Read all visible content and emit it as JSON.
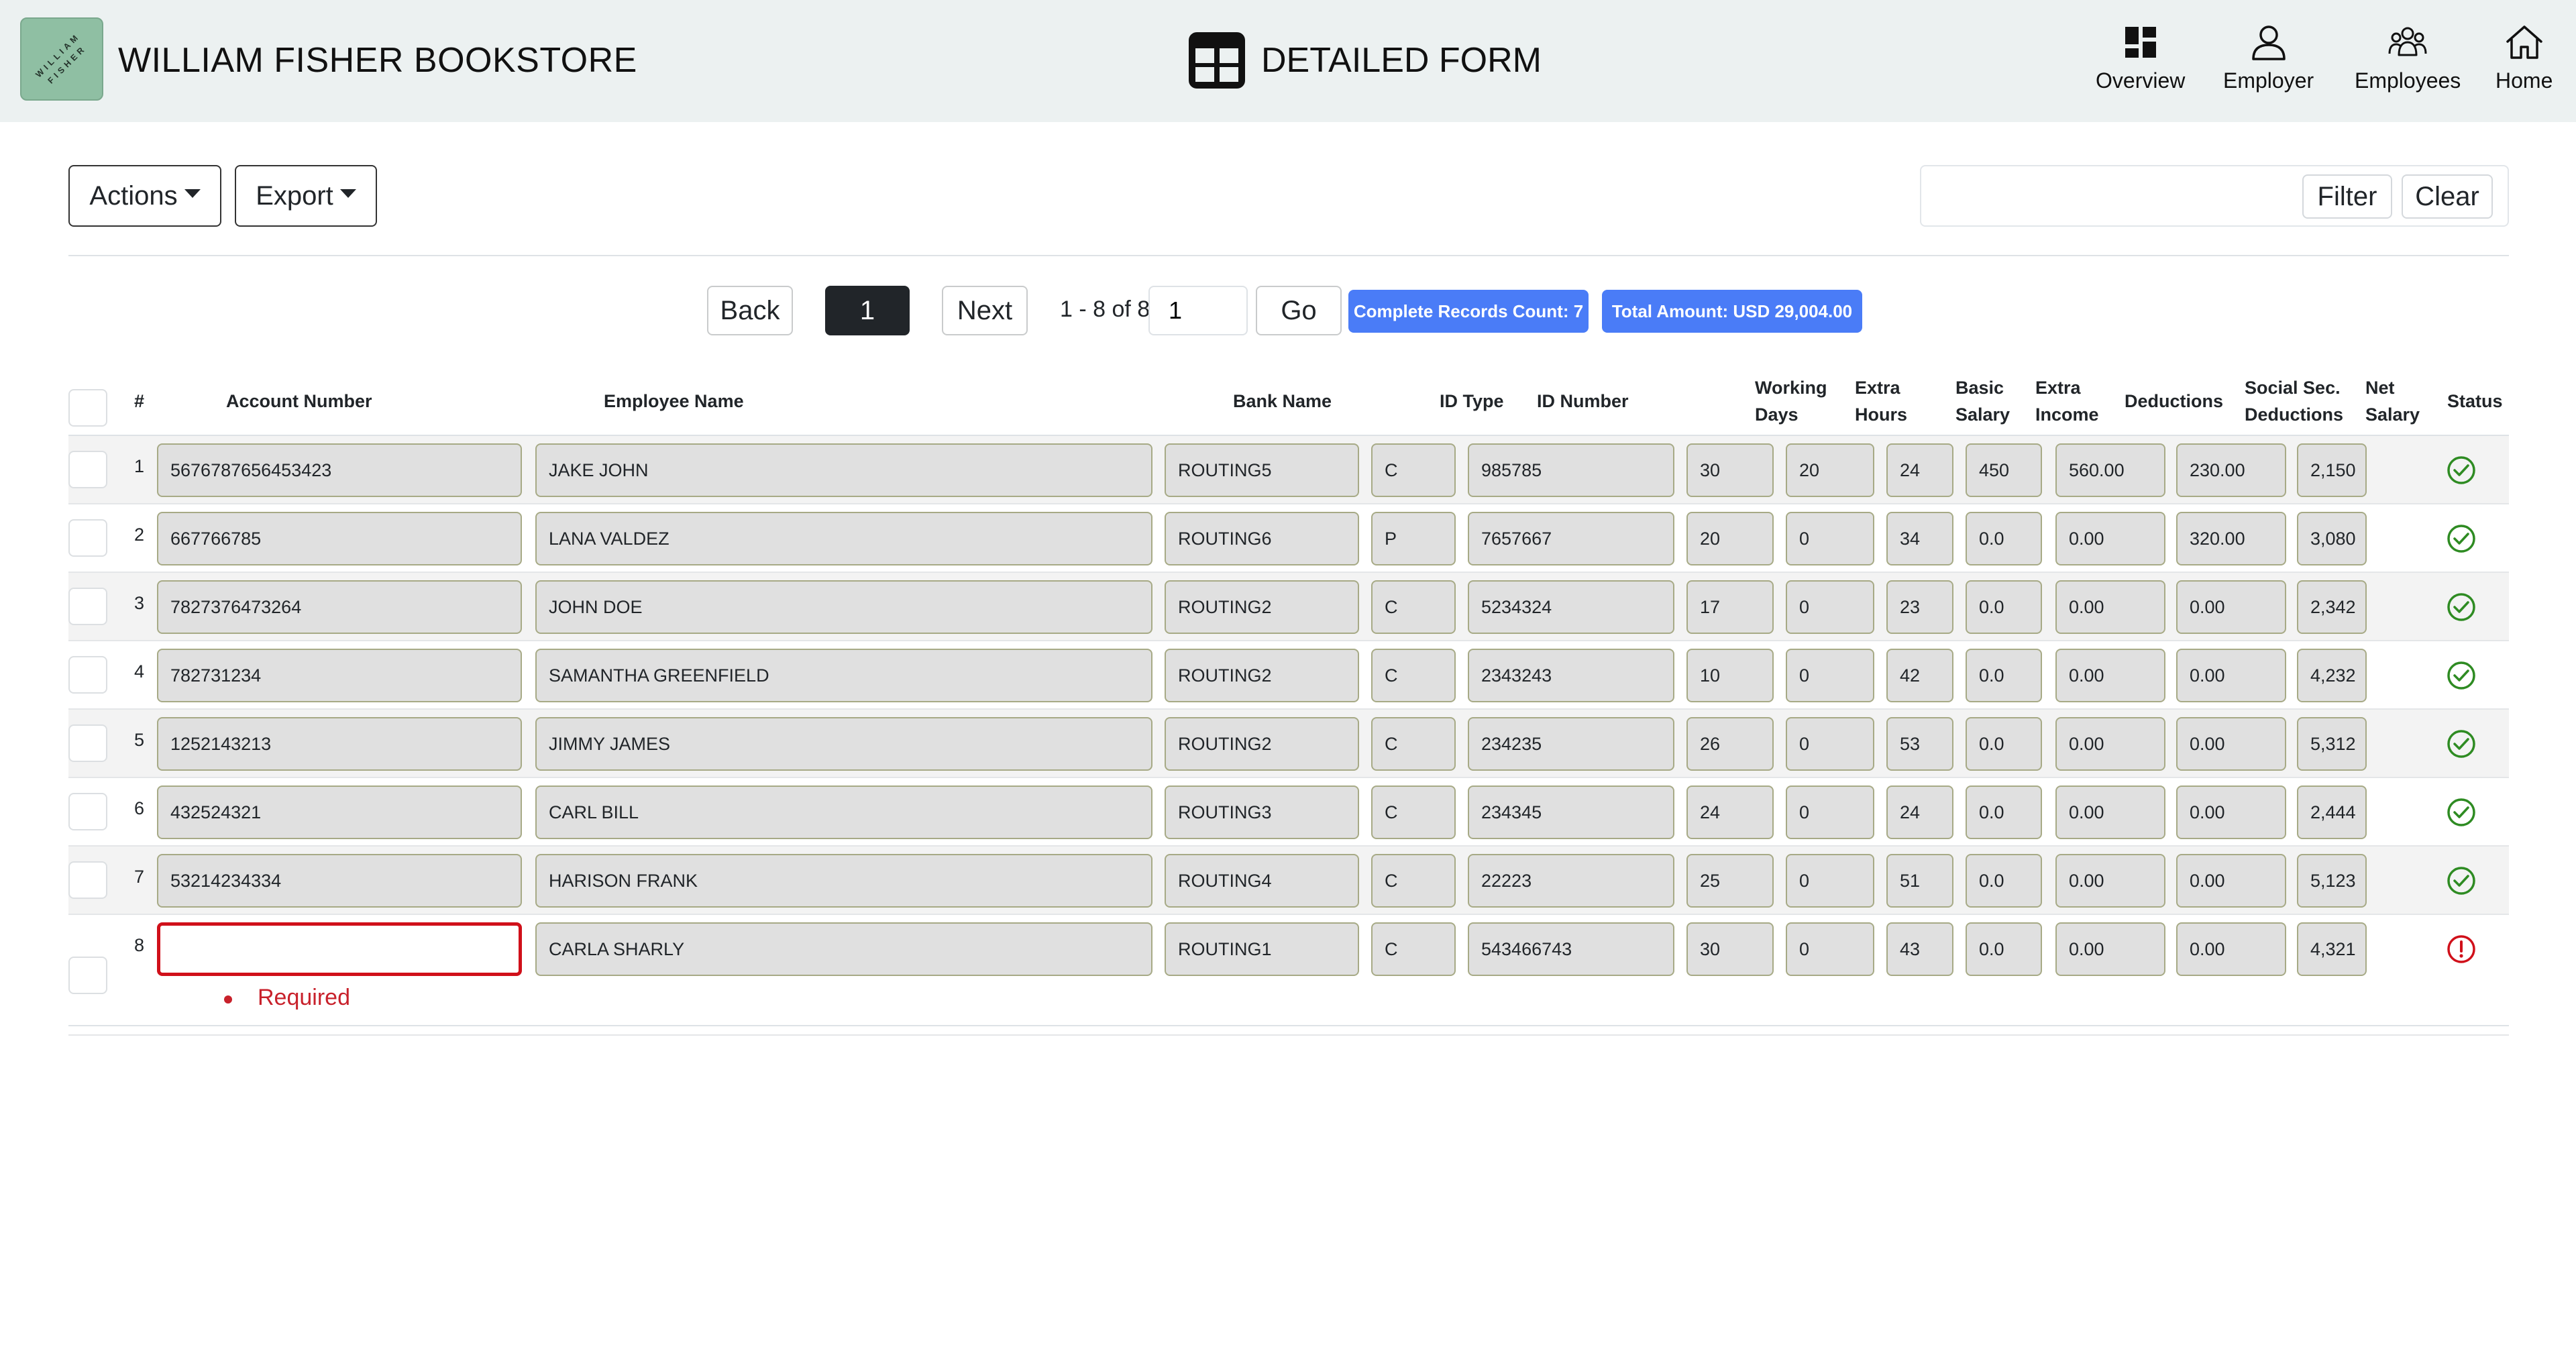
{
  "header": {
    "brand": "WILLIAM FISHER BOOKSTORE",
    "form_title": "DETAILED FORM",
    "nav": [
      {
        "label": "Overview",
        "icon": "dashboard-icon"
      },
      {
        "label": "Employer",
        "icon": "person-icon"
      },
      {
        "label": "Employees",
        "icon": "group-icon"
      },
      {
        "label": "Home",
        "icon": "home-icon"
      }
    ]
  },
  "toolbar": {
    "actions_label": "Actions",
    "export_label": "Export",
    "filter_value": "",
    "filter_label": "Filter",
    "clear_label": "Clear"
  },
  "pagination": {
    "back_label": "Back",
    "current_page": "1",
    "next_label": "Next",
    "range_text": "1 - 8 of 8",
    "page_input_value": "1",
    "go_label": "Go",
    "complete_badge": "Complete Records Count: 7",
    "total_badge": "Total Amount: USD 29,004.00"
  },
  "table": {
    "columns": [
      "#",
      "Account Number",
      "Employee Name",
      "Bank Name",
      "ID Type",
      "ID Number",
      "Working Days",
      "Extra Hours",
      "Basic Salary",
      "Extra Income",
      "Deductions",
      "Social Sec. Deductions",
      "Net Salary",
      "Status"
    ],
    "header_lines": {
      "working_days": [
        "Working",
        "Days"
      ],
      "extra_hours": [
        "Extra",
        "Hours"
      ],
      "basic_salary": [
        "Basic",
        "Salary"
      ],
      "extra_income": [
        "Extra",
        "Income"
      ],
      "social_sec": [
        "Social Sec.",
        "Deductions"
      ],
      "net_salary": [
        "Net",
        "Salary"
      ]
    },
    "rows": [
      {
        "index": "1",
        "account": "5676787656453423",
        "name": "JAKE JOHN",
        "bank": "ROUTING5",
        "id_type": "C",
        "id_number": "985785",
        "working_days": "30",
        "extra_hours": "20",
        "basic_salary": "24",
        "extra_income": "450",
        "deductions": "560.00",
        "social_sec": "230.00",
        "net_salary": "2,150",
        "status": "ok"
      },
      {
        "index": "2",
        "account": "667766785",
        "name": "LANA VALDEZ",
        "bank": "ROUTING6",
        "id_type": "P",
        "id_number": "7657667",
        "working_days": "20",
        "extra_hours": "0",
        "basic_salary": "34",
        "extra_income": "0.0",
        "deductions": "0.00",
        "social_sec": "320.00",
        "net_salary": "3,080",
        "status": "ok"
      },
      {
        "index": "3",
        "account": "7827376473264",
        "name": "JOHN DOE",
        "bank": "ROUTING2",
        "id_type": "C",
        "id_number": "5234324",
        "working_days": "17",
        "extra_hours": "0",
        "basic_salary": "23",
        "extra_income": "0.0",
        "deductions": "0.00",
        "social_sec": "0.00",
        "net_salary": "2,342",
        "status": "ok"
      },
      {
        "index": "4",
        "account": "782731234",
        "name": "SAMANTHA GREENFIELD",
        "bank": "ROUTING2",
        "id_type": "C",
        "id_number": "2343243",
        "working_days": "10",
        "extra_hours": "0",
        "basic_salary": "42",
        "extra_income": "0.0",
        "deductions": "0.00",
        "social_sec": "0.00",
        "net_salary": "4,232",
        "status": "ok"
      },
      {
        "index": "5",
        "account": "1252143213",
        "name": "JIMMY JAMES",
        "bank": "ROUTING2",
        "id_type": "C",
        "id_number": "234235",
        "working_days": "26",
        "extra_hours": "0",
        "basic_salary": "53",
        "extra_income": "0.0",
        "deductions": "0.00",
        "social_sec": "0.00",
        "net_salary": "5,312",
        "status": "ok"
      },
      {
        "index": "6",
        "account": "432524321",
        "name": "CARL BILL",
        "bank": "ROUTING3",
        "id_type": "C",
        "id_number": "234345",
        "working_days": "24",
        "extra_hours": "0",
        "basic_salary": "24",
        "extra_income": "0.0",
        "deductions": "0.00",
        "social_sec": "0.00",
        "net_salary": "2,444",
        "status": "ok"
      },
      {
        "index": "7",
        "account": "53214234334",
        "name": "HARISON FRANK",
        "bank": "ROUTING4",
        "id_type": "C",
        "id_number": "22223",
        "working_days": "25",
        "extra_hours": "0",
        "basic_salary": "51",
        "extra_income": "0.0",
        "deductions": "0.00",
        "social_sec": "0.00",
        "net_salary": "5,123",
        "status": "ok"
      },
      {
        "index": "8",
        "account": "",
        "name": "CARLA SHARLY",
        "bank": "ROUTING1",
        "id_type": "C",
        "id_number": "543466743",
        "working_days": "30",
        "extra_hours": "0",
        "basic_salary": "43",
        "extra_income": "0.0",
        "deductions": "0.00",
        "social_sec": "0.00",
        "net_salary": "4,321",
        "status": "error"
      }
    ],
    "error_message": "Required"
  },
  "colors": {
    "header_bg": "#ecf1f1",
    "badge_blue": "#4a7cf7",
    "ok_green": "#2e8b22",
    "error_red": "#d0101a"
  }
}
